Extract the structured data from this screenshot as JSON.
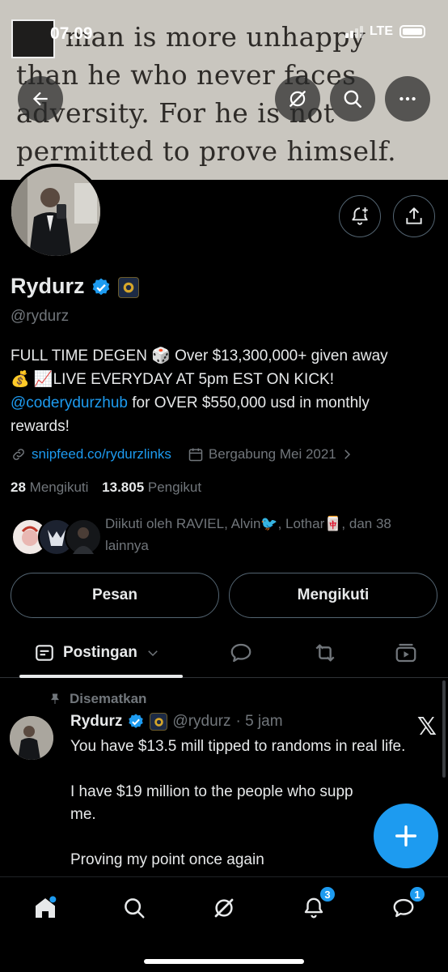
{
  "status_bar": {
    "time": "07.09",
    "network": "LTE"
  },
  "banner": {
    "quote_lines": [
      "No man is more unhappy",
      "than he who never faces",
      "adversity. For he is not",
      "permitted to prove himself."
    ]
  },
  "profile": {
    "name": "Rydurz",
    "handle": "@rydurz",
    "bio_line1": "FULL TIME DEGEN 🎲 Over $13,300,000+ given away",
    "bio_line2": "💰 📈LIVE EVERYDAY AT 5pm EST ON KICK!",
    "bio_mention": "@coderydurzhub",
    "bio_line3_rest": " for OVER $550,000 usd in monthly",
    "bio_line4": "rewards!",
    "website": "snipfeed.co/rydurzlinks",
    "joined": "Bergabung Mei 2021",
    "following_count": "28",
    "following_label": "Mengikuti",
    "followers_count": "13.805",
    "followers_label": "Pengikut",
    "followed_by": "Diikuti oleh RAVIEL, Alvin🐦, Lothar🀄, dan 38 lainnya"
  },
  "buttons": {
    "message": "Pesan",
    "following": "Mengikuti"
  },
  "tabs": {
    "active": "Postingan"
  },
  "post": {
    "pinned_label": "Disematkan",
    "author_name": "Rydurz",
    "author_handle": "@rydurz",
    "time": "· 5 jam",
    "text": "You have $13.5 mill tipped to randoms in real life.\n\nI have $19 million to the people who supp\nme.\n\nProving my point once again"
  },
  "nav": {
    "notifications_badge": "3",
    "messages_badge": "1"
  },
  "colors": {
    "accent": "#1d9bf0",
    "background": "#000000",
    "muted": "#71767b"
  }
}
